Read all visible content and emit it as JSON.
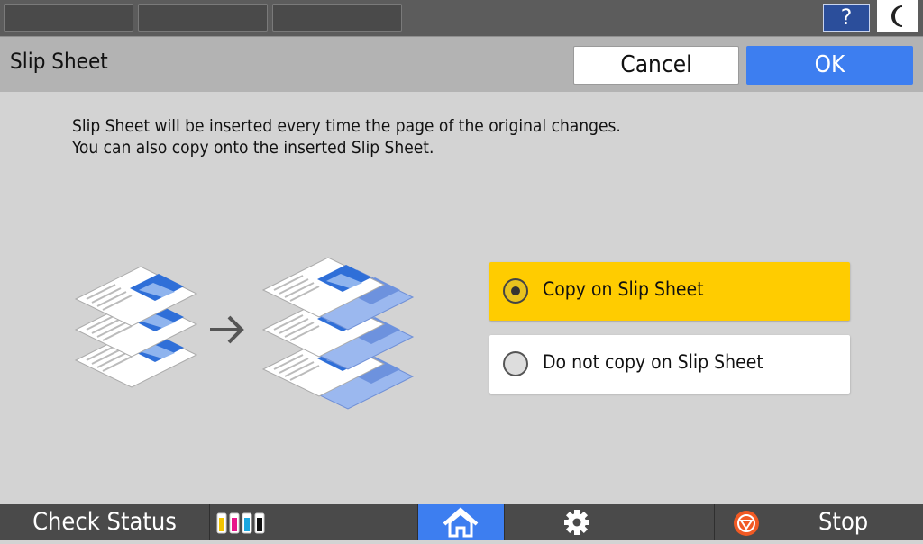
{
  "topbar": {
    "tabs": [
      "",
      "",
      ""
    ],
    "help_label": "?",
    "sleep_icon": "moon-icon"
  },
  "header": {
    "title": "Slip Sheet",
    "cancel_label": "Cancel",
    "ok_label": "OK"
  },
  "content": {
    "description_line1": "Slip Sheet will be inserted every time the page of the original changes.",
    "description_line2": "You can also copy onto the inserted Slip Sheet.",
    "options": [
      {
        "label": "Copy on Slip Sheet",
        "selected": true
      },
      {
        "label": "Do not copy on Slip Sheet",
        "selected": false
      }
    ]
  },
  "bottombar": {
    "check_status_label": "Check Status",
    "toner_colors": [
      "#f2c400",
      "#e8168a",
      "#1aa7e0",
      "#111111"
    ],
    "home_icon": "home-icon",
    "settings_icon": "gear-icon",
    "stop_label": "Stop"
  },
  "colors": {
    "accent_blue": "#3d7ef0",
    "selected_yellow": "#ffcc00"
  }
}
